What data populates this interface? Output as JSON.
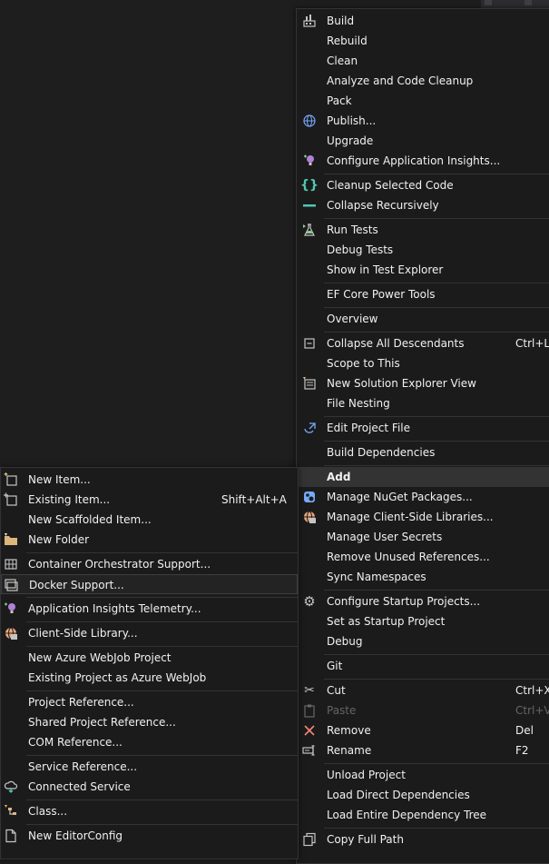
{
  "main_menu": {
    "items": [
      {
        "label": "Build",
        "icon": "build-icon",
        "color": "#c5c5c5"
      },
      {
        "label": "Rebuild"
      },
      {
        "label": "Clean"
      },
      {
        "label": "Analyze and Code Cleanup"
      },
      {
        "label": "Pack"
      },
      {
        "label": "Publish...",
        "icon": "globe-icon",
        "color": "#75a9f9"
      },
      {
        "label": "Upgrade"
      },
      {
        "label": "Configure Application Insights...",
        "icon": "lightbulb-icon",
        "color": "#b180d7"
      },
      {
        "label": "Cleanup Selected Code",
        "icon": "braces-icon",
        "color": "#4ec9b0"
      },
      {
        "label": "Collapse Recursively",
        "icon": "dash-icon",
        "color": "#4ec9b0"
      },
      {
        "label": "Run Tests",
        "icon": "flask-icon",
        "color": "#89d185"
      },
      {
        "label": "Debug Tests"
      },
      {
        "label": "Show in Test Explorer"
      },
      {
        "label": "EF Core Power Tools"
      },
      {
        "label": "Overview"
      },
      {
        "label": "Collapse All Descendants",
        "icon": "collapse-icon",
        "color": "#c5c5c5",
        "shortcut": "Ctrl+Le"
      },
      {
        "label": "Scope to This"
      },
      {
        "label": "New Solution Explorer View",
        "icon": "new-view-icon",
        "color": "#dcb67a"
      },
      {
        "label": "File Nesting"
      },
      {
        "label": "Edit Project File",
        "icon": "edit-file-icon",
        "color": "#75a9f9"
      },
      {
        "label": "Build Dependencies"
      },
      {
        "label": "Add"
      },
      {
        "label": "Manage NuGet Packages...",
        "icon": "nuget-icon",
        "color": "#75a9f9"
      },
      {
        "label": "Manage Client-Side Libraries...",
        "icon": "client-lib-icon",
        "color": "#e8a87c"
      },
      {
        "label": "Manage User Secrets"
      },
      {
        "label": "Remove Unused References..."
      },
      {
        "label": "Sync Namespaces"
      },
      {
        "label": "Configure Startup Projects...",
        "icon": "gear-icon",
        "color": "#c5c5c5"
      },
      {
        "label": "Set as Startup Project"
      },
      {
        "label": "Debug"
      },
      {
        "label": "Git"
      },
      {
        "label": "Cut",
        "icon": "scissors-icon",
        "color": "#c5c5c5",
        "shortcut": "Ctrl+X"
      },
      {
        "label": "Paste",
        "icon": "clipboard-icon",
        "color": "#c5c5c5",
        "shortcut": "Ctrl+V"
      },
      {
        "label": "Remove",
        "icon": "x-icon",
        "color": "#f48771",
        "shortcut": "Del"
      },
      {
        "label": "Rename",
        "icon": "rename-icon",
        "color": "#c5c5c5",
        "shortcut": "F2"
      },
      {
        "label": "Unload Project"
      },
      {
        "label": "Load Direct Dependencies"
      },
      {
        "label": "Load Entire Dependency Tree"
      },
      {
        "label": "Copy Full Path",
        "icon": "copy-icon",
        "color": "#c5c5c5"
      }
    ]
  },
  "add_submenu": {
    "items": [
      {
        "label": "New Item...",
        "icon": "new-item-icon",
        "color": "#dcb67a"
      },
      {
        "label": "Existing Item...",
        "icon": "existing-item-icon",
        "color": "#c5c5c5",
        "shortcut": "Shift+Alt+A"
      },
      {
        "label": "New Scaffolded Item..."
      },
      {
        "label": "New Folder",
        "icon": "folder-icon",
        "color": "#dcb67a"
      },
      {
        "label": "Container Orchestrator Support...",
        "icon": "container-icon",
        "color": "#c5c5c5"
      },
      {
        "label": "Docker Support...",
        "icon": "docker-icon",
        "color": "#c5c5c5"
      },
      {
        "label": "Application Insights Telemetry...",
        "icon": "lightbulb-icon",
        "color": "#b180d7"
      },
      {
        "label": "Client-Side Library...",
        "icon": "client-lib-icon",
        "color": "#e8a87c"
      },
      {
        "label": "New Azure WebJob Project"
      },
      {
        "label": "Existing Project as Azure WebJob"
      },
      {
        "label": "Project Reference..."
      },
      {
        "label": "Shared Project Reference..."
      },
      {
        "label": "COM Reference..."
      },
      {
        "label": "Service Reference..."
      },
      {
        "label": "Connected Service",
        "icon": "connected-service-icon",
        "color": "#4ec9b0"
      },
      {
        "label": "Class...",
        "icon": "class-icon",
        "color": "#dcb67a"
      },
      {
        "label": "New EditorConfig",
        "icon": "file-icon",
        "color": "#c5c5c5"
      }
    ]
  }
}
